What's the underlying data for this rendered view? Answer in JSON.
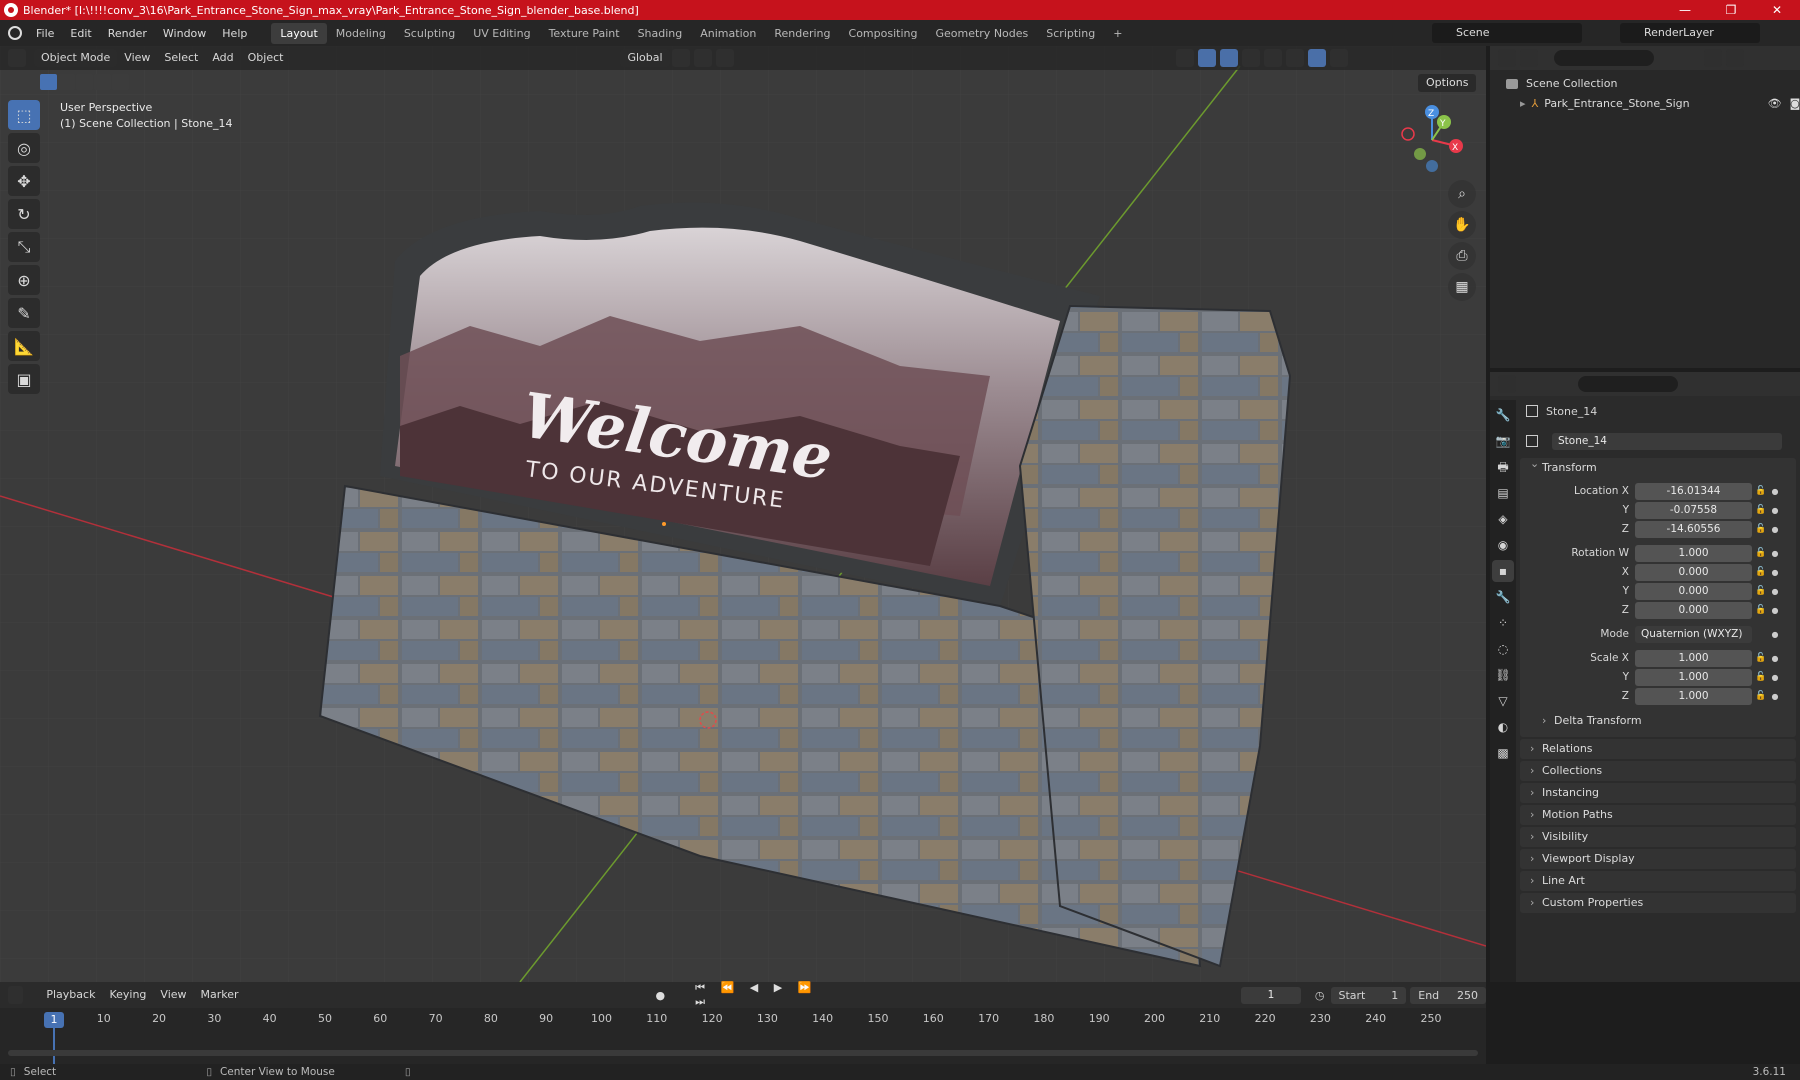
{
  "window": {
    "title": "Blender* [I:\\!!!!conv_3\\16\\Park_Entrance_Stone_Sign_max_vray\\Park_Entrance_Stone_Sign_blender_base.blend]",
    "minimize": "—",
    "maximize": "❐",
    "close": "✕"
  },
  "menu": {
    "items": [
      "File",
      "Edit",
      "Render",
      "Window",
      "Help"
    ],
    "workspaces": [
      "Layout",
      "Modeling",
      "Sculpting",
      "UV Editing",
      "Texture Paint",
      "Shading",
      "Animation",
      "Rendering",
      "Compositing",
      "Geometry Nodes",
      "Scripting"
    ],
    "active_workspace": "Layout",
    "add_tab": "+",
    "scene": "Scene",
    "view_layer": "RenderLayer"
  },
  "viewport": {
    "mode": "Object Mode",
    "menus": [
      "View",
      "Select",
      "Add",
      "Object"
    ],
    "orientation": "Global",
    "options": "Options",
    "perspective": "User Perspective",
    "collection_info": "(1) Scene Collection | Stone_14",
    "sign_title": "Welcome",
    "sign_subtitle": "TO OUR ADVENTURE",
    "gizmo_axes": {
      "x": "X",
      "y": "Y",
      "z": "Z"
    }
  },
  "tools": [
    {
      "name": "select-box-tool",
      "glyph": "⬚"
    },
    {
      "name": "cursor-tool",
      "glyph": "◎"
    },
    {
      "name": "move-tool",
      "glyph": "✥"
    },
    {
      "name": "rotate-tool",
      "glyph": "↻"
    },
    {
      "name": "scale-tool",
      "glyph": "⤡"
    },
    {
      "name": "transform-tool",
      "glyph": "⊕"
    },
    {
      "name": "annotate-tool",
      "glyph": "✎"
    },
    {
      "name": "measure-tool",
      "glyph": "📐"
    },
    {
      "name": "add-cube-tool",
      "glyph": "▣"
    }
  ],
  "outliner": {
    "root": "Scene Collection",
    "items": [
      "Park_Entrance_Stone_Sign"
    ]
  },
  "properties": {
    "object_name": "Stone_14",
    "data_name": "Stone_14",
    "transform_label": "Transform",
    "location": {
      "label": "Location X",
      "x": "-16.01344",
      "y": "-0.07558",
      "z": "-14.60556"
    },
    "rotation": {
      "label": "Rotation W",
      "w": "1.000",
      "x": "0.000",
      "y": "0.000",
      "z": "0.000"
    },
    "axis_labels": {
      "x": "X",
      "y": "Y",
      "z": "Z"
    },
    "mode_label": "Mode",
    "mode_value": "Quaternion (WXYZ)",
    "scale": {
      "label": "Scale X",
      "x": "1.000",
      "y": "1.000",
      "z": "1.000"
    },
    "delta_transform": "Delta Transform",
    "panels": [
      "Relations",
      "Collections",
      "Instancing",
      "Motion Paths",
      "Visibility",
      "Viewport Display",
      "Line Art",
      "Custom Properties"
    ]
  },
  "timeline": {
    "menus": [
      "Playback",
      "Keying",
      "View",
      "Marker"
    ],
    "current_frame": "1",
    "start_label": "Start",
    "start": "1",
    "end_label": "End",
    "end": "250",
    "ticks": [
      "1",
      "10",
      "20",
      "30",
      "40",
      "50",
      "60",
      "70",
      "80",
      "90",
      "100",
      "110",
      "120",
      "130",
      "140",
      "150",
      "160",
      "170",
      "180",
      "190",
      "200",
      "210",
      "220",
      "230",
      "240",
      "250"
    ]
  },
  "status": {
    "select": "Select",
    "center_view": "Center View to Mouse",
    "version": "3.6.11"
  },
  "colors": {
    "accent": "#4772b3",
    "titlebar": "#c6121c",
    "x_axis": "#e8394a",
    "y_axis": "#8bc34a",
    "z_axis": "#4a8fe0"
  }
}
